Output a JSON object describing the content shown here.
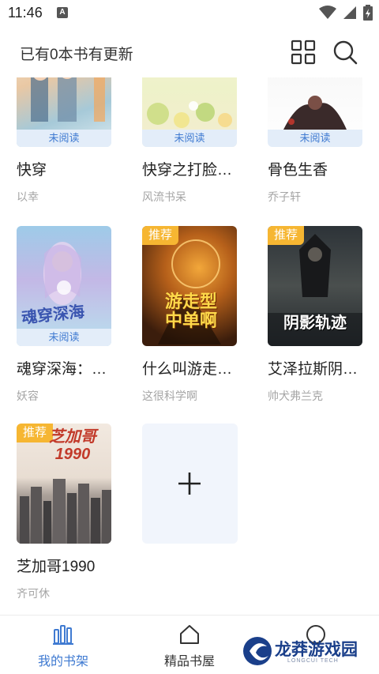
{
  "status_bar": {
    "time": "11:46",
    "notif_glyph": "A"
  },
  "header": {
    "update_text": "已有0本书有更新"
  },
  "books": [
    {
      "title": "快穿",
      "author": "以幸",
      "label": "未阅读",
      "badge": ""
    },
    {
      "title": "快穿之打脸…",
      "author": "风流书呆",
      "label": "未阅读",
      "badge": ""
    },
    {
      "title": "骨色生香",
      "author": "乔子轩",
      "label": "未阅读",
      "badge": ""
    },
    {
      "title": "魂穿深海：…",
      "author": "妖容",
      "label": "未阅读",
      "badge": "",
      "cover_text": "魂穿深海"
    },
    {
      "title": "什么叫游走…",
      "author": "这很科学啊",
      "label": "",
      "badge": "推荐",
      "cover_text": "游走型 中单啊"
    },
    {
      "title": "艾泽拉斯阴…",
      "author": "帅犬弗兰克",
      "label": "",
      "badge": "推荐",
      "cover_text": "阴影轨迹"
    },
    {
      "title": "芝加哥1990",
      "author": "齐可休",
      "label": "",
      "badge": "推荐",
      "cover_text": "芝加哥 1990"
    }
  ],
  "bottom_nav": {
    "items": [
      {
        "label": "我的书架",
        "icon": "bookshelf-icon",
        "active": true
      },
      {
        "label": "精品书屋",
        "icon": "house-icon",
        "active": false
      }
    ]
  },
  "watermark": {
    "text": "龙莽游戏园",
    "sub": "LONGCUI TECH"
  },
  "colors": {
    "accent": "#3f7ad1",
    "badge": "#f6b632",
    "unread_bg": "#e3edf9"
  }
}
